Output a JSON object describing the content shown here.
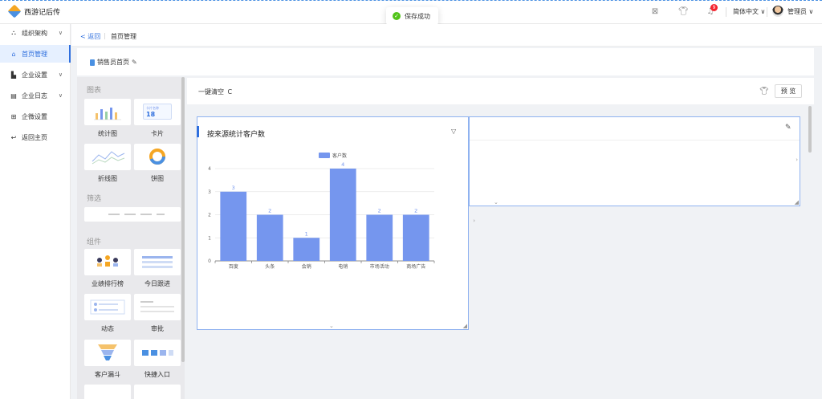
{
  "app": {
    "title": "西游记后传"
  },
  "toast": {
    "message": "保存成功"
  },
  "topbar": {
    "notification_count": "9",
    "language": "简体中文 ∨",
    "user": "管理员 ∨"
  },
  "nav": {
    "items": [
      {
        "label": "组织架构",
        "icon": "org-icon",
        "glyph": "⛬"
      },
      {
        "label": "首页管理",
        "icon": "home-icon",
        "glyph": "⌂"
      },
      {
        "label": "企业设置",
        "icon": "building-icon",
        "glyph": "▙"
      },
      {
        "label": "企业日志",
        "icon": "log-icon",
        "glyph": "▤"
      },
      {
        "label": "企微设置",
        "icon": "grid-icon",
        "glyph": "⊞"
      },
      {
        "label": "返回主页",
        "icon": "return-icon",
        "glyph": "↩"
      }
    ]
  },
  "breadcrumb": {
    "back": "< 返回",
    "separator": "|",
    "title": "首页管理"
  },
  "page_tab": {
    "label": "销售员首页"
  },
  "palette": {
    "section_charts": "图表",
    "section_filter": "筛选",
    "section_components": "组件",
    "chart_tiles": [
      "统计图",
      "卡片",
      "折线图",
      "饼图"
    ],
    "card_tile_label": "卡片名称",
    "card_tile_value": "18",
    "component_tiles": [
      "业绩排行榜",
      "今日跟进",
      "动态",
      "审批",
      "客户漏斗",
      "快捷入口"
    ]
  },
  "canvas": {
    "clear_label": "一键清空",
    "clear_glyph": "C",
    "preview_label": "预 览"
  },
  "card": {
    "title": "按来源统计客户数",
    "filter_glyph": "▽"
  },
  "colors": {
    "accent": "#2f6fde",
    "bar": "#7596ee",
    "success": "#52c41a",
    "badge": "#f5222d"
  },
  "chart_data": {
    "type": "bar",
    "title": "",
    "legend": [
      "客户数"
    ],
    "legend_position": "top",
    "categories": [
      "百度",
      "头条",
      "会销",
      "电销",
      "市场活动",
      "商场广告"
    ],
    "series": [
      {
        "name": "客户数",
        "values": [
          3,
          2,
          1,
          4,
          2,
          2
        ]
      }
    ],
    "ylim": [
      0,
      4
    ],
    "yticks": [
      0,
      1,
      2,
      3,
      4
    ],
    "grid": true,
    "xlabel": "",
    "ylabel": ""
  }
}
